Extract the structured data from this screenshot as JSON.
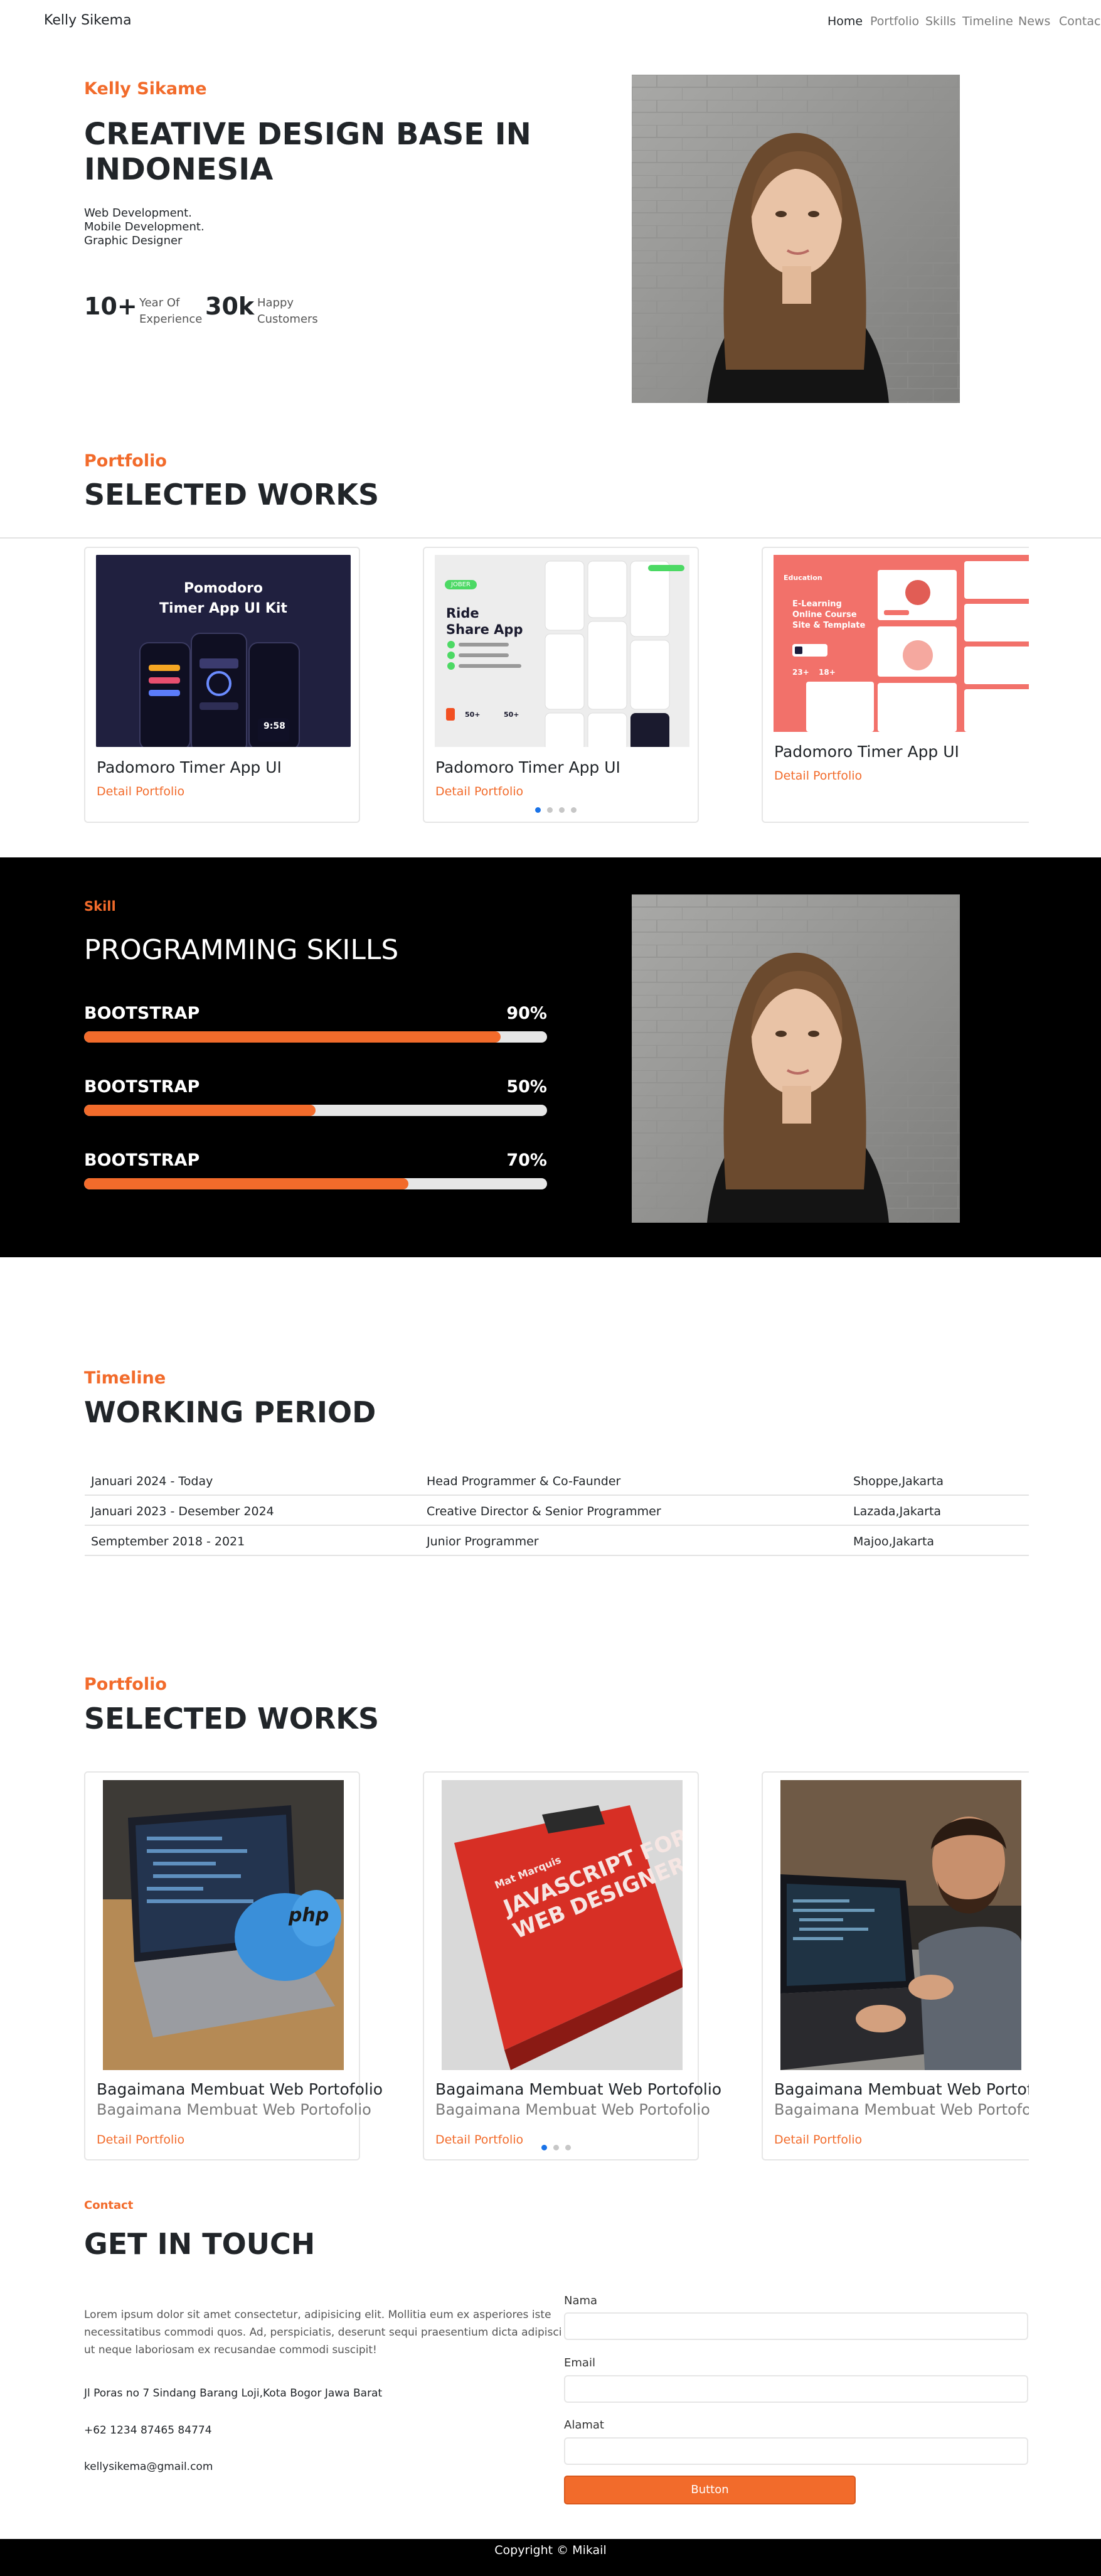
{
  "navbar": {
    "brand": "Kelly Sikema",
    "links": [
      "Home",
      "Portfolio",
      "Skills",
      "Timeline",
      "News",
      "Contact"
    ]
  },
  "hero": {
    "name": "Kelly Sikame",
    "headline_line1": "CREATIVE DESIGN BASE IN",
    "headline_line2": "INDONESIA",
    "roles": [
      "Web Development.",
      "Mobile Development.",
      "Graphic Designer"
    ],
    "stats": [
      {
        "value": "10+",
        "label_line1": "Year Of",
        "label_line2": "Experience"
      },
      {
        "value": "30k",
        "label_line1": "Happy",
        "label_line2": "Customers"
      }
    ]
  },
  "portfolio": {
    "eyebrow": "Portfolio",
    "title": "SELECTED WORKS",
    "cards": [
      {
        "title": "Padomoro Timer App UI",
        "link": "Detail Portfolio",
        "thumb_title_1": "Pomodoro",
        "thumb_title_2": "Timer App UI  Kit",
        "thumb_time": "9:58"
      },
      {
        "title": "Padomoro Timer App UI",
        "link": "Detail Portfolio",
        "thumb_badge": "JOBER",
        "thumb_title_1": "Ride",
        "thumb_title_2": "Share App",
        "thumb_stat_1": "50+",
        "thumb_stat_2": "50+"
      },
      {
        "title": "Padomoro Timer App UI",
        "link": "Detail Portfolio",
        "thumb_brand": "Education",
        "thumb_title_1": "E-Learning",
        "thumb_title_2": "Online Course",
        "thumb_title_3": "Site & Template",
        "thumb_stat_1": "23+",
        "thumb_stat_2": "18+"
      }
    ]
  },
  "skills": {
    "eyebrow": "Skill",
    "title": "PROGRAMMING SKILLS",
    "items": [
      {
        "name": "BOOTSTRAP",
        "percent_label": "90%",
        "level": 0.9
      },
      {
        "name": "BOOTSTRAP",
        "percent_label": "50%",
        "level": 0.5
      },
      {
        "name": "BOOTSTRAP",
        "percent_label": "70%",
        "level": 0.7
      }
    ]
  },
  "timeline": {
    "eyebrow": "Timeline",
    "title": "WORKING PERIOD",
    "rows": [
      {
        "period": "Januari 2024 - Today",
        "role": "Head Programmer & Co-Faunder",
        "company": "Shoppe,Jakarta"
      },
      {
        "period": "Januari 2023 - Desember 2024",
        "role": "Creative Director & Senior Programmer",
        "company": "Lazada,Jakarta"
      },
      {
        "period": "Semptember 2018 - 2021",
        "role": "Junior Programmer",
        "company": "Majoo,Jakarta"
      }
    ]
  },
  "news": {
    "eyebrow": "Portfolio",
    "title": "SELECTED WORKS",
    "cards": [
      {
        "title": "Bagaimana Membuat Web Portofolio",
        "subtitle": "Bagaimana Membuat Web Portofolio",
        "link": "Detail Portfolio",
        "thumb_text": "php"
      },
      {
        "title": "Bagaimana Membuat Web Portofolio",
        "subtitle": "Bagaimana Membuat Web Portofolio",
        "link": "Detail Portfolio",
        "thumb_text_1": "JAVASCRIPT FOR",
        "thumb_text_2": "WEB DESIGNERS",
        "thumb_text_3": "Mat Marquis"
      },
      {
        "title": "Bagaimana Membuat Web Portofolio",
        "subtitle": "Bagaimana Membuat Web Portofolio",
        "link": "Detail Portfolio"
      }
    ]
  },
  "contact": {
    "eyebrow": "Contact",
    "title": "GET IN TOUCH",
    "intro_1": "Lorem ipsum dolor sit amet consectetur, adipisicing elit. Mollitia eum ex asperiores iste",
    "intro_2": "necessitatibus commodi quos. Ad, perspiciatis, deserunt sequi praesentium dicta adipisci",
    "intro_3": "ut neque laboriosam ex recusandae commodi suscipit!",
    "address": "Jl Poras no 7 Sindang Barang Loji,Kota Bogor Jawa Barat",
    "phone": "+62 1234 87465 84774",
    "email": "kellysikema@gmail.com",
    "form": {
      "name_label": "Nama",
      "email_label": "Email",
      "address_label": "Alamat",
      "button": "Button"
    }
  },
  "footer": {
    "text": "Copyright © Mikail"
  },
  "colors": {
    "accent": "#f26b2b",
    "dark": "#212529",
    "skills_bg": "#000000",
    "footer_bg": "#000000"
  }
}
